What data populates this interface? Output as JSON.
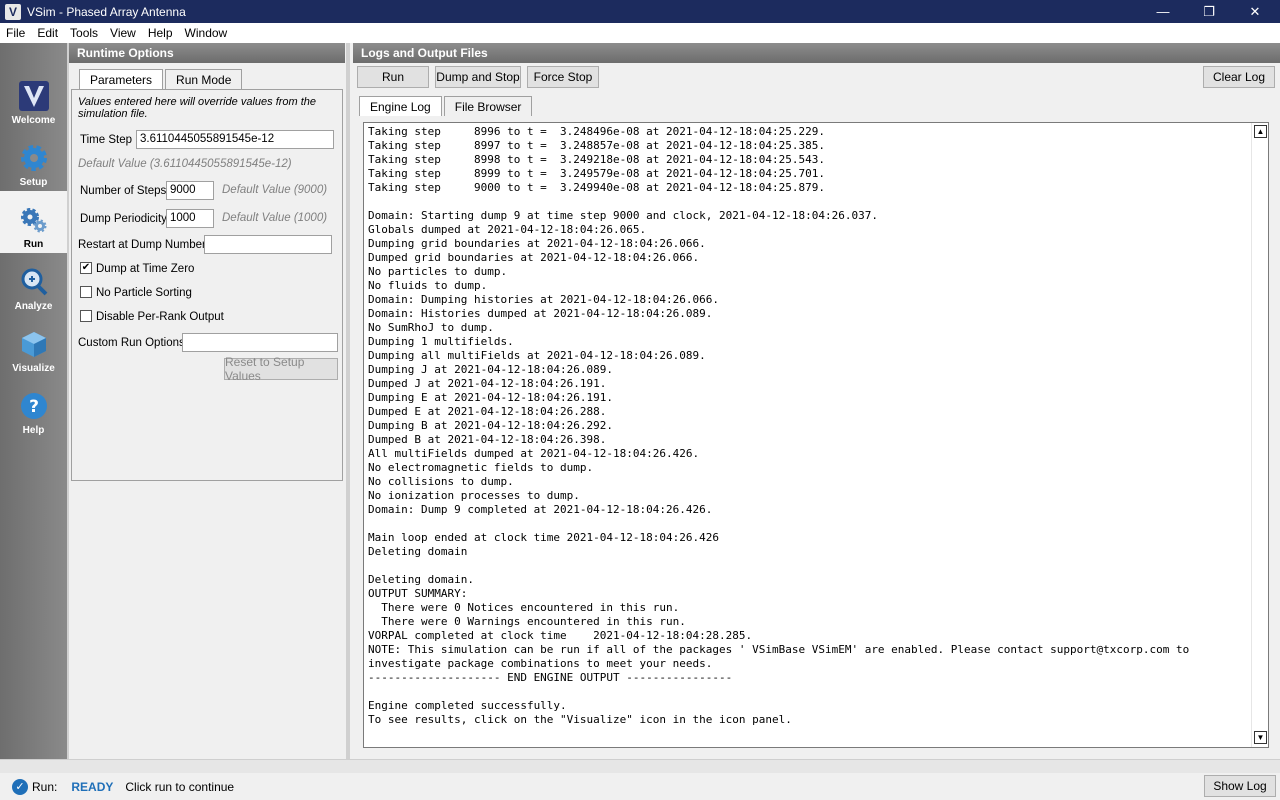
{
  "window": {
    "title": "VSim - Phased Array Antenna",
    "minimize": "—",
    "restore": "❐",
    "close": "✕"
  },
  "menu": [
    "File",
    "Edit",
    "Tools",
    "View",
    "Help",
    "Window"
  ],
  "icon_panel": [
    {
      "label": "Welcome",
      "icon": "vsim-logo-icon"
    },
    {
      "label": "Setup",
      "icon": "gear-icon"
    },
    {
      "label": "Run",
      "icon": "gears-icon"
    },
    {
      "label": "Analyze",
      "icon": "magnifier-icon"
    },
    {
      "label": "Visualize",
      "icon": "cube-icon"
    },
    {
      "label": "Help",
      "icon": "question-icon"
    }
  ],
  "runtime": {
    "header": "Runtime Options",
    "tabs": [
      "Parameters",
      "Run Mode"
    ],
    "note": "Values entered here will override values from the simulation file.",
    "time_step_label": "Time Step",
    "time_step_value": "3.6110445055891545e-12",
    "time_step_default": "Default Value (3.6110445055891545e-12)",
    "num_steps_label": "Number of Steps",
    "num_steps_value": "9000",
    "num_steps_default": "Default Value (9000)",
    "dump_period_label": "Dump Periodicity",
    "dump_period_value": "1000",
    "dump_period_default": "Default Value (1000)",
    "restart_label": "Restart at Dump Number",
    "restart_value": "",
    "dump_zero_label": "Dump at Time Zero",
    "no_particle_label": "No Particle Sorting",
    "disable_rank_label": "Disable Per-Rank Output",
    "custom_label": "Custom Run Options",
    "custom_value": "",
    "reset_button": "Reset to Setup Values"
  },
  "logs": {
    "header": "Logs and Output Files",
    "run_button": "Run",
    "dump_stop_button": "Dump and Stop",
    "force_stop_button": "Force Stop",
    "clear_log_button": "Clear Log",
    "tabs": [
      "Engine Log",
      "File Browser"
    ],
    "text": "Taking step     8996 to t =  3.248496e-08 at 2021-04-12-18:04:25.229.\nTaking step     8997 to t =  3.248857e-08 at 2021-04-12-18:04:25.385.\nTaking step     8998 to t =  3.249218e-08 at 2021-04-12-18:04:25.543.\nTaking step     8999 to t =  3.249579e-08 at 2021-04-12-18:04:25.701.\nTaking step     9000 to t =  3.249940e-08 at 2021-04-12-18:04:25.879.\n\nDomain: Starting dump 9 at time step 9000 and clock, 2021-04-12-18:04:26.037.\nGlobals dumped at 2021-04-12-18:04:26.065.\nDumping grid boundaries at 2021-04-12-18:04:26.066.\nDumped grid boundaries at 2021-04-12-18:04:26.066.\nNo particles to dump.\nNo fluids to dump.\nDomain: Dumping histories at 2021-04-12-18:04:26.066.\nDomain: Histories dumped at 2021-04-12-18:04:26.089.\nNo SumRhoJ to dump.\nDumping 1 multifields.\nDumping all multiFields at 2021-04-12-18:04:26.089.\nDumping J at 2021-04-12-18:04:26.089.\nDumped J at 2021-04-12-18:04:26.191.\nDumping E at 2021-04-12-18:04:26.191.\nDumped E at 2021-04-12-18:04:26.288.\nDumping B at 2021-04-12-18:04:26.292.\nDumped B at 2021-04-12-18:04:26.398.\nAll multiFields dumped at 2021-04-12-18:04:26.426.\nNo electromagnetic fields to dump.\nNo collisions to dump.\nNo ionization processes to dump.\nDomain: Dump 9 completed at 2021-04-12-18:04:26.426.\n\nMain loop ended at clock time 2021-04-12-18:04:26.426\nDeleting domain\n\nDeleting domain.\nOUTPUT SUMMARY:\n  There were 0 Notices encountered in this run.\n  There were 0 Warnings encountered in this run.\nVORPAL completed at clock time    2021-04-12-18:04:28.285.\nNOTE: This simulation can be run if all of the packages ' VSimBase VSimEM' are enabled. Please contact support@txcorp.com to\ninvestigate package combinations to meet your needs.\n-------------------- END ENGINE OUTPUT ----------------\n\nEngine completed successfully.\nTo see results, click on the \"Visualize\" icon in the icon panel."
  },
  "status": {
    "run_label": "Run:",
    "state": "READY",
    "message": "Click run to continue",
    "show_log_button": "Show Log"
  },
  "colors": {
    "titlebar": "#1c2b5e",
    "ready": "#1f6fb8"
  }
}
